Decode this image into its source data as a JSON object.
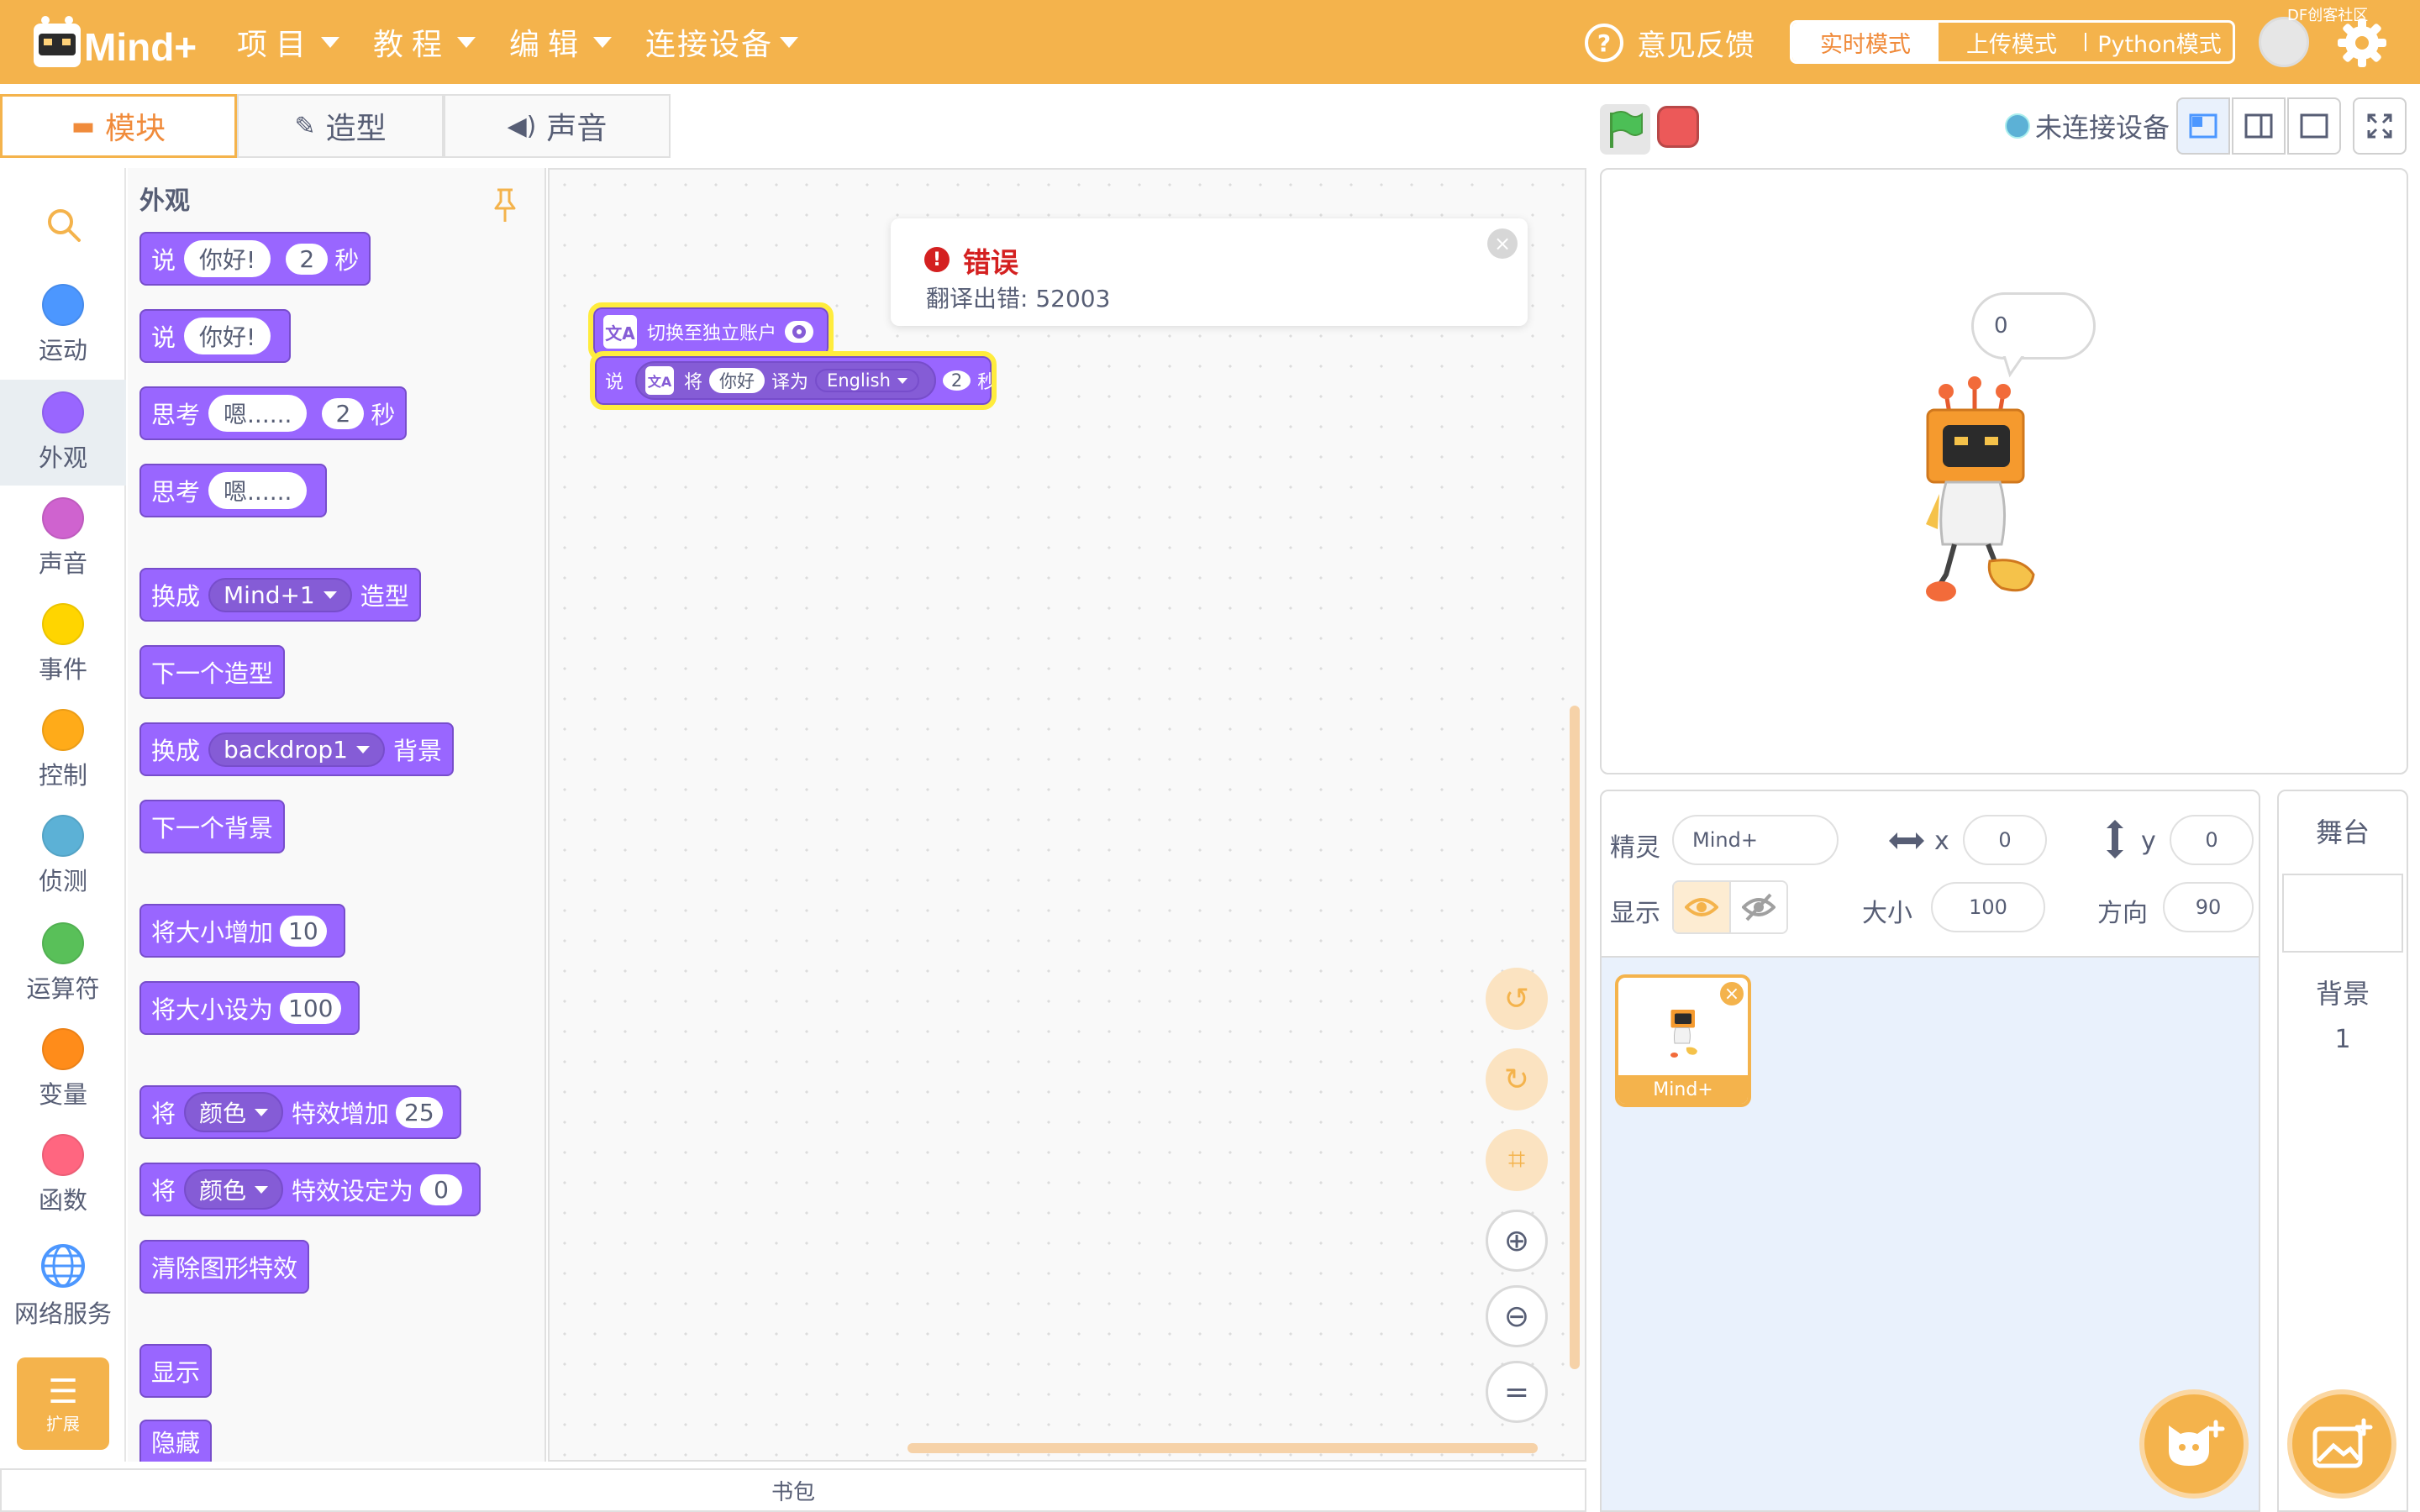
{
  "app": {
    "name": "Mind+"
  },
  "menu": [
    {
      "label": "项目"
    },
    {
      "label": "教程"
    },
    {
      "label": "编辑"
    },
    {
      "label": "连接设备"
    }
  ],
  "header": {
    "feedback": "意见反馈",
    "modes": [
      "实时模式",
      "上传模式",
      "Python模式"
    ],
    "badge": "DF创客社区"
  },
  "tabs": [
    "模块",
    "造型",
    "声音"
  ],
  "categories": [
    {
      "label": "运动",
      "color": "#4c97ff"
    },
    {
      "label": "外观",
      "color": "#9966ff"
    },
    {
      "label": "声音",
      "color": "#cf63cf"
    },
    {
      "label": "事件",
      "color": "#ffd500"
    },
    {
      "label": "控制",
      "color": "#ffab19"
    },
    {
      "label": "侦测",
      "color": "#5cb1d6"
    },
    {
      "label": "运算符",
      "color": "#59c059"
    },
    {
      "label": "变量",
      "color": "#ff8c1a"
    },
    {
      "label": "函数",
      "color": "#ff6680"
    },
    {
      "label": "网络服务",
      "color": "#4c97ff"
    }
  ],
  "extension": {
    "label": "扩展"
  },
  "palette": {
    "title": "外观",
    "blocks": {
      "say_secs": {
        "t1": "说",
        "msg": "你好!",
        "secs": "2",
        "t2": "秒"
      },
      "say": {
        "t1": "说",
        "msg": "你好!"
      },
      "think_secs": {
        "t1": "思考",
        "msg": "嗯......",
        "secs": "2",
        "t2": "秒"
      },
      "think": {
        "t1": "思考",
        "msg": "嗯......"
      },
      "switch_costume": {
        "t1": "换成",
        "val": "Mind+1",
        "t2": "造型"
      },
      "next_costume": {
        "t1": "下一个造型"
      },
      "switch_backdrop": {
        "t1": "换成",
        "val": "backdrop1",
        "t2": "背景"
      },
      "next_backdrop": {
        "t1": "下一个背景"
      },
      "change_size": {
        "t1": "将大小增加",
        "val": "10"
      },
      "set_size": {
        "t1": "将大小设为",
        "val": "100"
      },
      "change_effect": {
        "t1": "将",
        "val": "颜色",
        "t2": "特效增加",
        "num": "25"
      },
      "set_effect": {
        "t1": "将",
        "val": "颜色",
        "t2": "特效设定为",
        "num": "0"
      },
      "clear_effects": {
        "t1": "清除图形特效"
      },
      "show": {
        "t1": "显示"
      },
      "hide": {
        "t1": "隐藏"
      }
    }
  },
  "workspace": {
    "block1": {
      "label": "切换至独立账户"
    },
    "block2": {
      "t1": "说",
      "t2": "将",
      "msg": "你好",
      "t3": "译为",
      "lang": "English",
      "secs": "2",
      "t4": "秒"
    }
  },
  "error": {
    "title": "错误",
    "message": "翻译出错: 52003"
  },
  "backpack": "书包",
  "stage": {
    "connection": "未连接设备",
    "bubble": "0"
  },
  "sprite_info": {
    "sprite_label": "精灵",
    "sprite_name": "Mind+",
    "x_label": "x",
    "x": "0",
    "y_label": "y",
    "y": "0",
    "show_label": "显示",
    "size_label": "大小",
    "size": "100",
    "direction_label": "方向",
    "direction": "90"
  },
  "sprites": [
    {
      "name": "Mind+"
    }
  ],
  "stage_pane": {
    "title": "舞台",
    "backdrop_label": "背景",
    "backdrop_count": "1"
  },
  "colors": {
    "accent": "#f4b34c",
    "looks": "#9966ff",
    "error": "#d42020"
  }
}
